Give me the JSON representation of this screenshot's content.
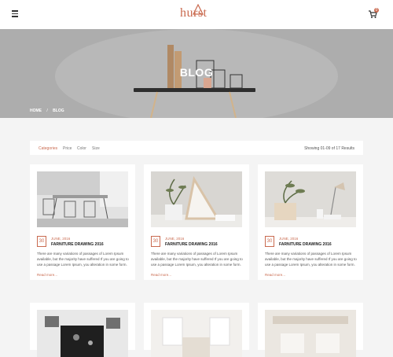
{
  "brand": {
    "logo": "hurst"
  },
  "cart": {
    "count": "0"
  },
  "hero": {
    "title": "BLOG"
  },
  "breadcrumb": {
    "home": "HOME",
    "separator": "/",
    "current": "BLOG"
  },
  "filters": {
    "items": [
      "Categories",
      "Price",
      "Color",
      "Size"
    ],
    "active": "Categories",
    "showing": "Showing 01-09 of 17 Results"
  },
  "posts": [
    {
      "day": "30",
      "date": "JUNE, 2016",
      "title": "FARNITURE DRAWING 2016",
      "excerpt": "There are many variations of passages of Lorem Ipsum available, but the majority have suffered If you are going to use a passage Lorem Ipsum, you alteration in some form.",
      "read_more": "Read more..."
    },
    {
      "day": "30",
      "date": "JUNE, 2016",
      "title": "FARNITURE DRAWING 2016",
      "excerpt": "There are many variations of passages of Lorem Ipsum available, but the majority have suffered If you are going to use a passage Lorem Ipsum, you alteration in some form.",
      "read_more": "Read more..."
    },
    {
      "day": "30",
      "date": "JUNE, 2016",
      "title": "FARNITURE DRAWING 2016",
      "excerpt": "There are many variations of passages of Lorem Ipsum available, but the majority have suffered If you are going to use a passage Lorem Ipsum, you alteration in some form.",
      "read_more": "Read more..."
    }
  ],
  "colors": {
    "accent": "#c96a4f",
    "background": "#f4f4f4"
  },
  "icons": {
    "menu": "hamburger-icon",
    "cart": "cart-icon"
  }
}
